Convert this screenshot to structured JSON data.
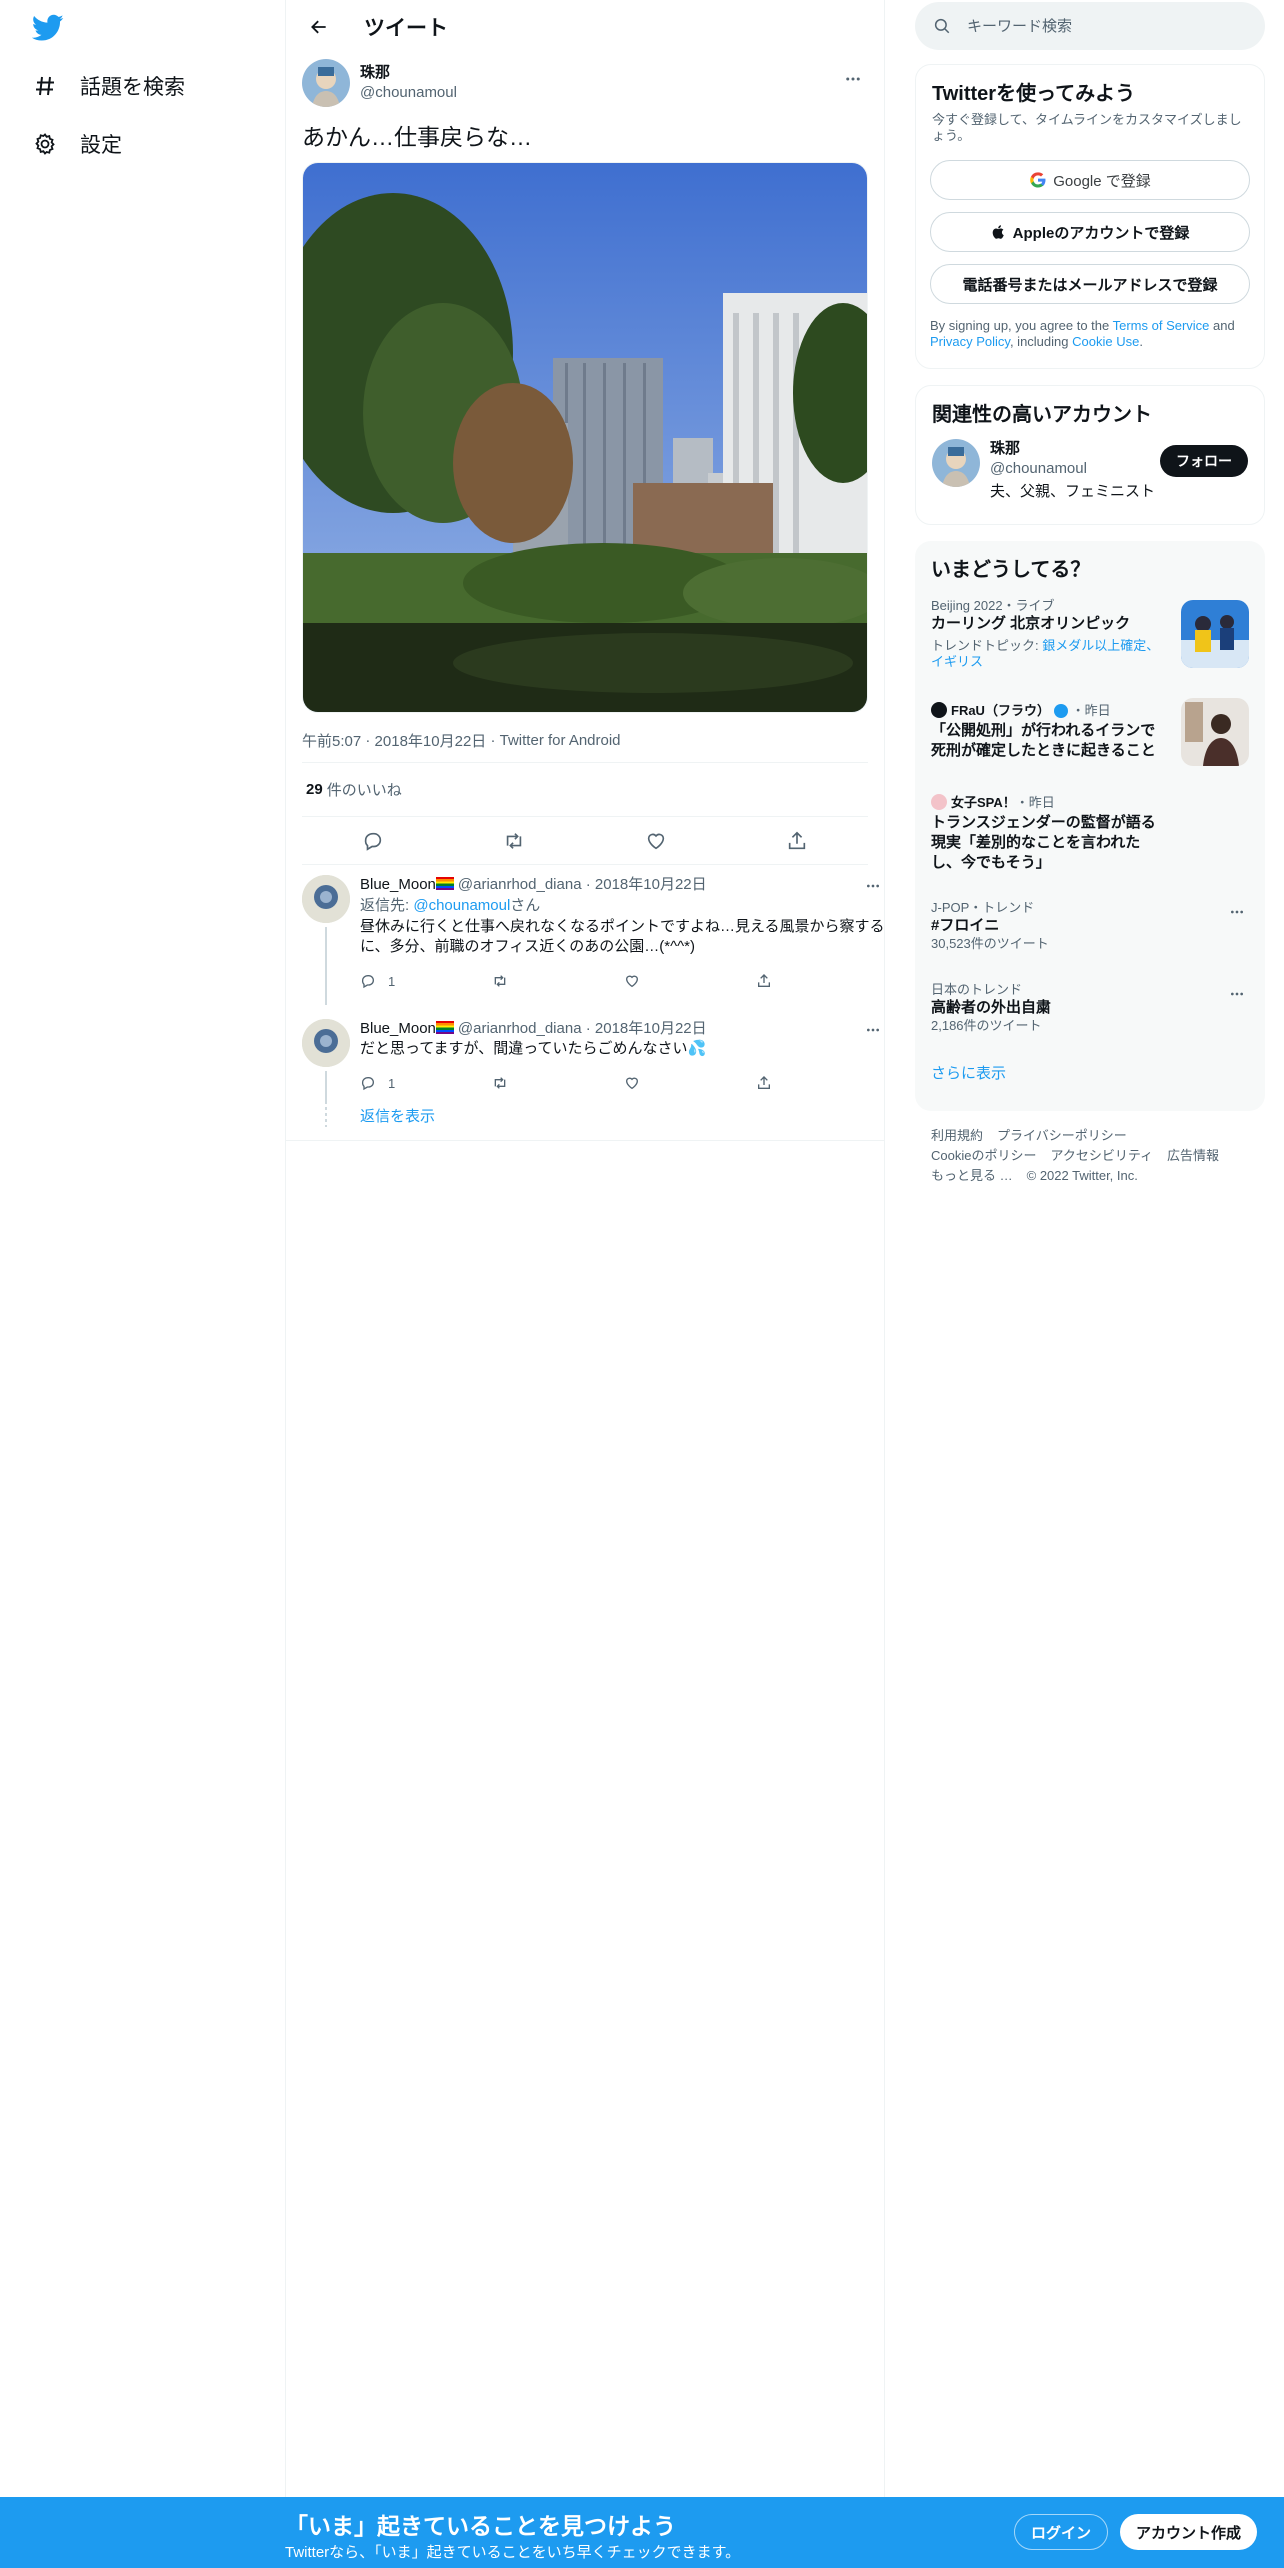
{
  "nav": {
    "items": [
      {
        "label": "話題を検索",
        "icon": "hashtag-icon"
      },
      {
        "label": "設定",
        "icon": "gear-icon"
      }
    ]
  },
  "header": {
    "title": "ツイート"
  },
  "tweet": {
    "author_name": "珠那",
    "author_handle": "@chounamoul",
    "text": "あかん…仕事戻らな…",
    "time": "午前5:07",
    "date": "2018年10月22日",
    "source": "Twitter for Android",
    "like_count": "29",
    "like_label": "件のいいね"
  },
  "replies": [
    {
      "name": "Blue_Moon",
      "handle": "@arianrhod_diana",
      "date": "2018年10月22日",
      "reply_to_prefix": "返信先: ",
      "reply_to_handle": "@chounamoul",
      "reply_to_suffix": "さん",
      "text": "昼休みに行くと仕事へ戻れなくなるポイントですよね…見える風景から察するに、多分、前職のオフィス近くのあの公園…(*^^*)",
      "reply_count": "1"
    },
    {
      "name": "Blue_Moon",
      "handle": "@arianrhod_diana",
      "date": "2018年10月22日",
      "text": "だと思ってますが、間違っていたらごめんなさい💦",
      "reply_count": "1"
    }
  ],
  "show_replies": "返信を表示",
  "search": {
    "placeholder": "キーワード検索"
  },
  "signup": {
    "title": "Twitterを使ってみよう",
    "subtitle": "今すぐ登録して、タイムラインをカスタマイズしましょう。",
    "google_btn": "Google で登録",
    "apple_btn": "Appleのアカウントで登録",
    "phone_btn": "電話番号またはメールアドレスで登録",
    "terms_prefix": "By signing up, you agree to the ",
    "terms_link": "Terms of Service",
    "terms_and": " and ",
    "privacy_link": "Privacy Policy",
    "terms_including": ", including ",
    "cookie_link": "Cookie Use",
    "terms_end": "."
  },
  "related": {
    "title": "関連性の高いアカウント",
    "name": "珠那",
    "handle": "@chounamoul",
    "bio": "夫、父親、フェミニスト",
    "follow_btn": "フォロー"
  },
  "trends": {
    "title": "いまどうしてる？",
    "items": [
      {
        "category": "Beijing 2022・ライブ",
        "name": "カーリング 北京オリンピック",
        "sub_prefix": "トレンドトピック: ",
        "sub_link": "銀メダル以上確定、イギリス"
      },
      {
        "source": "FRaU（フラウ）",
        "time": "・昨日",
        "name": "「公開処刑」が行われるイランで死刑が確定したときに起きること"
      },
      {
        "source": "女子SPA！",
        "time": "・昨日",
        "name": "トランスジェンダーの監督が語る現実「差別的なことを言われたし、今でもそう」"
      },
      {
        "category": "J-POP・トレンド",
        "name": "#フロイニ",
        "count": "30,523件のツイート"
      },
      {
        "category": "日本のトレンド",
        "name": "高齢者の外出自粛",
        "count": "2,186件のツイート"
      }
    ],
    "show_more": "さらに表示"
  },
  "footer": {
    "links": [
      "利用規約",
      "プライバシーポリシー",
      "Cookieのポリシー",
      "アクセシビリティ",
      "広告情報",
      "もっと見る …"
    ],
    "copyright": "© 2022 Twitter, Inc."
  },
  "bottom_bar": {
    "title": "「いま」起きていることを見つけよう",
    "subtitle": "Twitterなら、「いま」起きていることをいち早くチェックできます。",
    "login": "ログイン",
    "signup": "アカウント作成"
  },
  "colors": {
    "brand": "#1d9bf0",
    "text": "#0f1419",
    "secondary": "#536471"
  }
}
